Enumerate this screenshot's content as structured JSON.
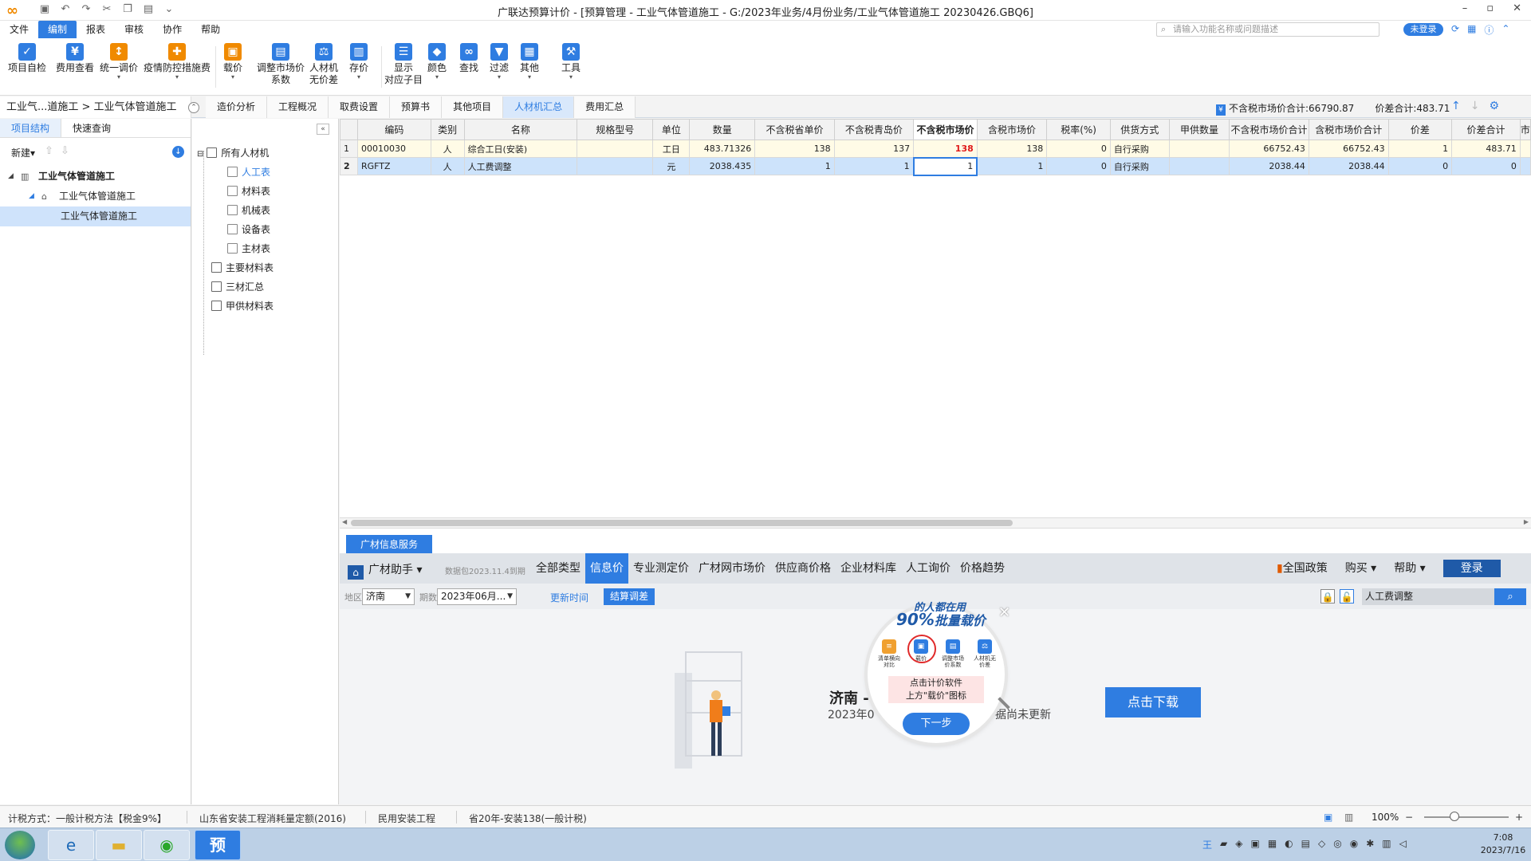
{
  "titlebar": {
    "title": "广联达预算计价 - [预算管理 - 工业气体管道施工 - G:/2023年业务/4月份业务/工业气体管道施工 20230426.GBQ6]",
    "controls": [
      "–",
      "▫",
      "✕"
    ]
  },
  "menu": {
    "items": [
      "文件",
      "编制",
      "报表",
      "审核",
      "协作",
      "帮助"
    ],
    "active": "编制",
    "search_placeholder": "请输入功能名称或问题描述",
    "login": "未登录"
  },
  "ribbon": {
    "buttons": [
      {
        "label1": "项目自检",
        "label2": "",
        "icon": "check-icon",
        "color": "#2f7de1"
      },
      {
        "label1": "费用查看",
        "label2": "",
        "icon": "view-fee-icon",
        "color": "#2f7de1"
      },
      {
        "label1": "统一调价",
        "label2": "",
        "icon": "adjust-price-icon",
        "color": "#f08a00"
      },
      {
        "label1": "疫情防控措施费",
        "label2": "",
        "icon": "epidemic-icon",
        "color": "#f08a00"
      },
      {
        "label1": "载价",
        "label2": "",
        "icon": "load-price-icon",
        "color": "#f08a00"
      },
      {
        "label1": "调整市场价",
        "label2": "系数",
        "icon": "market-coef-icon",
        "color": "#2f7de1"
      },
      {
        "label1": "人材机",
        "label2": "无价差",
        "icon": "balance-icon",
        "color": "#2f7de1"
      },
      {
        "label1": "存价",
        "label2": "",
        "icon": "save-price-icon",
        "color": "#2f7de1"
      },
      {
        "label1": "显示",
        "label2": "对应子目",
        "icon": "show-item-icon",
        "color": "#2f7de1"
      },
      {
        "label1": "颜色",
        "label2": "",
        "icon": "color-icon",
        "color": "#2f7de1"
      },
      {
        "label1": "查找",
        "label2": "",
        "icon": "binoculars-icon",
        "color": "#2f7de1"
      },
      {
        "label1": "过滤",
        "label2": "",
        "icon": "filter-icon",
        "color": "#2f7de1"
      },
      {
        "label1": "其他",
        "label2": "",
        "icon": "grid-icon",
        "color": "#2f7de1"
      },
      {
        "label1": "工具",
        "label2": "",
        "icon": "tools-icon",
        "color": "#2f7de1"
      }
    ]
  },
  "tabrow": {
    "breadcrumb": "工业气...道施工 > 工业气体管道施工",
    "tabs": [
      "造价分析",
      "工程概况",
      "取费设置",
      "预算书",
      "其他项目",
      "人材机汇总",
      "费用汇总"
    ],
    "active_tab": "人材机汇总",
    "summary_market": "不含税市场价合计:66790.87",
    "summary_diff": "价差合计:483.71"
  },
  "leftpane": {
    "tabs": [
      "项目结构",
      "快速查询"
    ],
    "new_label": "新建",
    "tree": [
      {
        "label": "工业气体管道施工",
        "level": 0
      },
      {
        "label": "工业气体管道施工",
        "level": 1
      },
      {
        "label": "工业气体管道施工",
        "level": 2
      }
    ]
  },
  "midtree": {
    "root": "所有人材机",
    "children": [
      "人工表",
      "材料表",
      "机械表",
      "设备表",
      "主材表"
    ],
    "others": [
      "主要材料表",
      "三材汇总",
      "甲供材料表"
    ],
    "selected": "人工表"
  },
  "grid": {
    "columns": [
      "编码",
      "类别",
      "名称",
      "规格型号",
      "单位",
      "数量",
      "不含税省单价",
      "不含税青岛价",
      "不含税市场价",
      "含税市场价",
      "税率(%)",
      "供货方式",
      "甲供数量",
      "不含税市场价合计",
      "含税市场价合计",
      "价差",
      "价差合计",
      "市"
    ],
    "rows": [
      {
        "no": "1",
        "code": "00010030",
        "type": "人",
        "name": "综合工日(安装)",
        "spec": "",
        "unit": "工日",
        "qty": "483.71326",
        "prov": "138",
        "qd": "137",
        "mkt": "138",
        "mkt_tax": "138",
        "rate": "0",
        "supply": "自行采购",
        "jia": "",
        "sum_mkt": "66752.43",
        "sum_tax": "66752.43",
        "diff": "1",
        "diff_sum": "483.71"
      },
      {
        "no": "2",
        "code": "RGFTZ",
        "type": "人",
        "name": "人工费调整",
        "spec": "",
        "unit": "元",
        "qty": "2038.435",
        "prov": "1",
        "qd": "1",
        "mkt": "1",
        "mkt_tax": "1",
        "rate": "0",
        "supply": "自行采购",
        "jia": "",
        "sum_mkt": "2038.44",
        "sum_tax": "2038.44",
        "diff": "0",
        "diff_sum": "0"
      }
    ]
  },
  "service": {
    "tab": "广材信息服务",
    "brand": "广材助手",
    "tip": "数据包2023.11.4到期",
    "nav": [
      "全部类型",
      "信息价",
      "专业测定价",
      "广材网市场价",
      "供应商价格",
      "企业材料库",
      "人工询价",
      "价格趋势"
    ],
    "nav_active": "信息价",
    "right": [
      "全国政策",
      "购买",
      "帮助"
    ],
    "login": "登录",
    "region_label": "地区",
    "region": "济南",
    "period_label": "期数",
    "period": "2023年06月...",
    "update_link": "更新时间",
    "settle_btn": "结算调差",
    "keyword": "人工费调整",
    "body_region": "济南 -",
    "body_year": "2023年0",
    "body_status": "据尚未更新",
    "download": "点击下载"
  },
  "popup": {
    "header_small": "的人都在用",
    "header_big": "90%",
    "header_text": "批量载价",
    "mini_buttons": [
      "清单横向对比",
      "载价",
      "调整市场价系数",
      "人材机无价差"
    ],
    "note_line1": "点击计价软件",
    "note_line2": "上方\"载价\"图标",
    "next": "下一步"
  },
  "statusbar": {
    "tax": "计税方式：一般计税方法【税金9%】",
    "quota": "山东省安装工程消耗量定额(2016)",
    "category": "民用安装工程",
    "labor": "省20年-安装138(一般计税)",
    "zoom": "100%"
  },
  "taskbar": {
    "time": "7:08",
    "date": "2023/7/16"
  }
}
